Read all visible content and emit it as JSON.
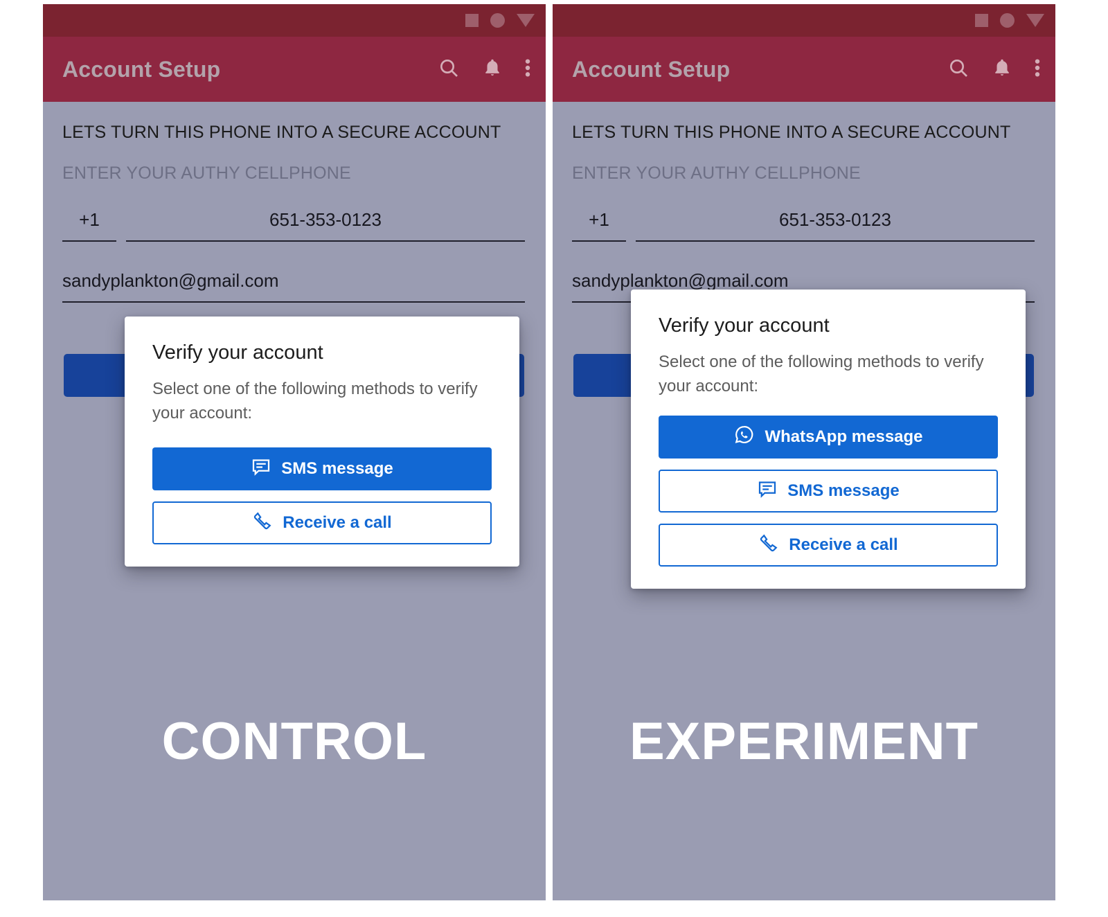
{
  "variants": [
    {
      "key": "control",
      "overlay_label": "CONTROL",
      "statusbar": {
        "icons": [
          "square-icon",
          "circle-icon",
          "triangle-down-icon"
        ]
      },
      "appbar": {
        "title": "Account Setup",
        "actions": [
          "search-icon",
          "bell-icon",
          "overflow-menu-icon"
        ]
      },
      "form": {
        "headline": "LETS TURN THIS PHONE INTO A SECURE ACCOUNT",
        "subline": "ENTER YOUR AUTHY CELLPHONE",
        "country_code": "+1",
        "phone_number": "651-353-0123",
        "email": "sandyplankton@gmail.com"
      },
      "dialog": {
        "title": "Verify your account",
        "subtitle": "Select one of the following methods to verify your account:",
        "buttons": [
          {
            "label": "SMS message",
            "icon": "sms-icon",
            "style": "filled"
          },
          {
            "label": "Receive a call",
            "icon": "phone-icon",
            "style": "outline"
          }
        ]
      }
    },
    {
      "key": "experiment",
      "overlay_label": "EXPERIMENT",
      "statusbar": {
        "icons": [
          "square-icon",
          "circle-icon",
          "triangle-down-icon"
        ]
      },
      "appbar": {
        "title": "Account Setup",
        "actions": [
          "search-icon",
          "bell-icon",
          "overflow-menu-icon"
        ]
      },
      "form": {
        "headline": "LETS TURN THIS PHONE INTO A SECURE ACCOUNT",
        "subline": "ENTER YOUR AUTHY CELLPHONE",
        "country_code": "+1",
        "phone_number": "651-353-0123",
        "email": "sandyplankton@gmail.com"
      },
      "dialog": {
        "title": "Verify your account",
        "subtitle": "Select one of the following methods to verify your account:",
        "buttons": [
          {
            "label": "WhatsApp message",
            "icon": "whatsapp-icon",
            "style": "filled"
          },
          {
            "label": "SMS message",
            "icon": "sms-icon",
            "style": "outline"
          },
          {
            "label": "Receive a call",
            "icon": "phone-icon",
            "style": "outline"
          }
        ]
      }
    }
  ],
  "colors": {
    "statusbar": "#7b2330",
    "appbar": "#8e2741",
    "screen_background": "#9a9cb2",
    "primary_blue": "#1268d3",
    "dimmed_cta_blue": "#17429a",
    "dialog_background": "#ffffff"
  }
}
